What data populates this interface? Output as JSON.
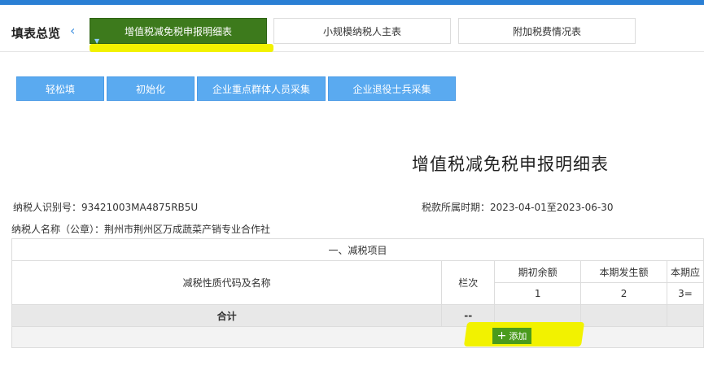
{
  "colors": {
    "topbar": "#2a7fd4",
    "active_tab": "#3d7a1c",
    "button": "#5aaaf0",
    "add_button": "#4a9b1c",
    "highlight": "#f2f200"
  },
  "nav": {
    "title": "填表总览",
    "back_icon": "chevron-left-icon",
    "tabs": [
      {
        "label": "增值税减免税申报明细表",
        "active": true
      },
      {
        "label": "小规模纳税人主表",
        "active": false
      },
      {
        "label": "附加税费情况表",
        "active": false
      }
    ]
  },
  "toolbar": {
    "buttons": [
      "轻松填",
      "初始化",
      "企业重点群体人员采集",
      "企业退役士兵采集"
    ]
  },
  "document": {
    "title": "增值税减免税申报明细表",
    "taxpayer_id_label": "纳税人识别号：",
    "taxpayer_id": "93421003MA4875RB5U",
    "period_label": "税款所属时期：",
    "period": "2023-04-01至2023-06-30",
    "taxpayer_name_label": "纳税人名称（公章）：",
    "taxpayer_name": "荆州市荆州区万成蔬菜产销专业合作社"
  },
  "table": {
    "section_title": "一、减税项目",
    "col_code_name": "减税性质代码及名称",
    "col_line": "栏次",
    "col_opening": "期初余额",
    "col_current": "本期发生额",
    "col_due": "本期应",
    "num_opening": "1",
    "num_current": "2",
    "num_due": "3=",
    "total_label": "合计",
    "total_line": "--",
    "add_label": "添加"
  }
}
